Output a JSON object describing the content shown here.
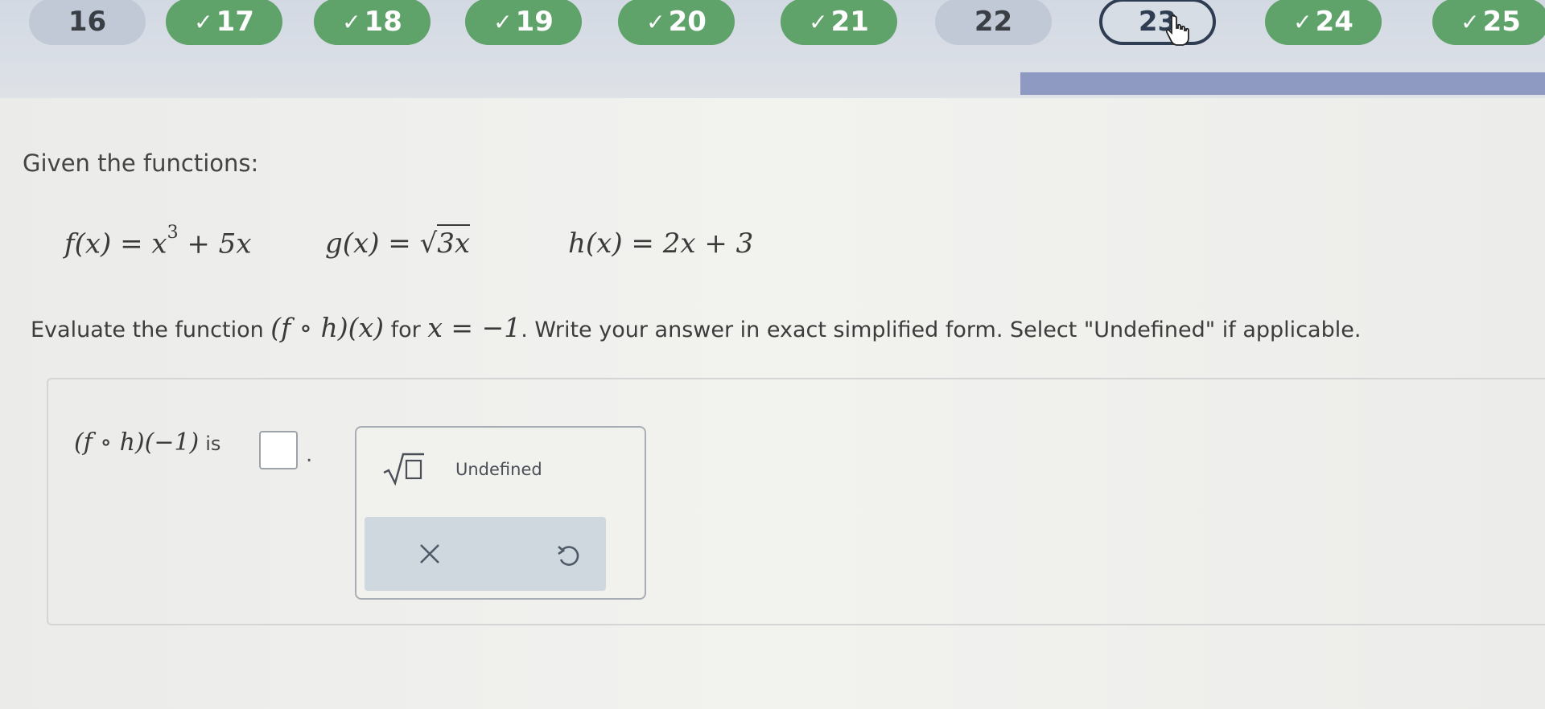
{
  "nav": {
    "questions": [
      {
        "number": "16",
        "status": "todo"
      },
      {
        "number": "17",
        "status": "done"
      },
      {
        "number": "18",
        "status": "done"
      },
      {
        "number": "19",
        "status": "done"
      },
      {
        "number": "20",
        "status": "done"
      },
      {
        "number": "21",
        "status": "done"
      },
      {
        "number": "22",
        "status": "todo"
      },
      {
        "number": "23",
        "status": "current"
      },
      {
        "number": "24",
        "status": "done"
      },
      {
        "number": "25",
        "status": "done"
      }
    ],
    "check_glyph": "✓",
    "done_color": "#5fa26a",
    "current_border_color": "#2f3d52"
  },
  "problem": {
    "intro": "Given the functions:",
    "f_def": {
      "lhs": "f(x) = x",
      "exp": "3",
      "rhs": " + 5x"
    },
    "g_def": {
      "lhs": "g(x) = ",
      "radicand": "3x"
    },
    "h_def": "h(x) = 2x + 3",
    "prompt_pre": "Evaluate the function ",
    "prompt_comp": "(f ∘ h)(x)",
    "prompt_mid": " for ",
    "prompt_val": "x = −1",
    "prompt_post": ". Write your answer in exact simplified form. Select \"Undefined\" if applicable."
  },
  "answer": {
    "expression": "(f ∘ h)(−1)",
    "is_label": "is",
    "value": "",
    "period": "."
  },
  "tools": {
    "sqrt_icon": "square-root-icon",
    "undefined_label": "Undefined",
    "clear_icon": "close-icon",
    "undo_icon": "undo-icon",
    "footer_color": "#cfd7df"
  }
}
